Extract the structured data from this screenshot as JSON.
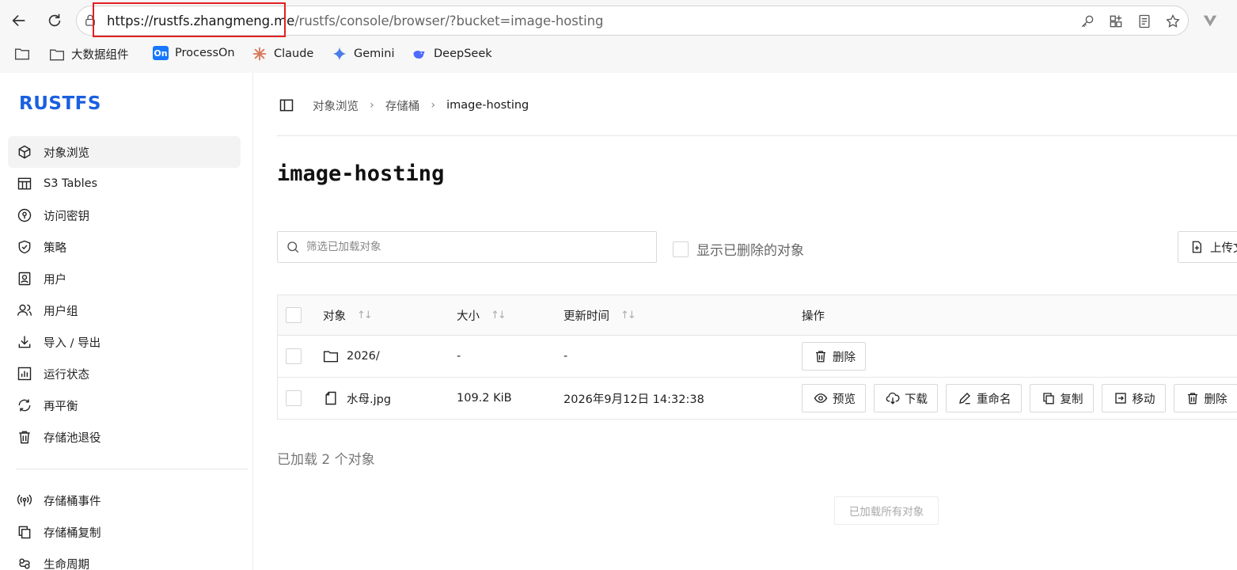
{
  "browser": {
    "url_host": "https://rustfs.zhangmeng.me",
    "url_path": "/rustfs/console/browser/?bucket=image-hosting",
    "bookmarks": [
      {
        "label": "大数据组件"
      },
      {
        "label": "ProcessOn",
        "logo_text": "On"
      },
      {
        "label": "Claude"
      },
      {
        "label": "Gemini"
      },
      {
        "label": "DeepSeek"
      }
    ]
  },
  "sidebar": {
    "logo": "RUSTFS",
    "items": [
      {
        "label": "对象浏览",
        "icon": "cube-icon",
        "active": true
      },
      {
        "label": "S3 Tables",
        "icon": "table-icon"
      },
      {
        "label": "访问密钥",
        "icon": "key-circle-icon"
      },
      {
        "label": "策略",
        "icon": "shield-check-icon"
      },
      {
        "label": "用户",
        "icon": "user-badge-icon"
      },
      {
        "label": "用户组",
        "icon": "users-icon"
      },
      {
        "label": "导入 / 导出",
        "icon": "download-icon"
      },
      {
        "label": "运行状态",
        "icon": "chart-icon"
      },
      {
        "label": "再平衡",
        "icon": "refresh-icon"
      },
      {
        "label": "存储池退役",
        "icon": "trash-icon"
      },
      {
        "label": "存储桶事件",
        "icon": "broadcast-icon"
      },
      {
        "label": "存储桶复制",
        "icon": "copy-icon"
      },
      {
        "label": "生命周期",
        "icon": "lifecycle-icon"
      }
    ]
  },
  "main": {
    "breadcrumbs": [
      "对象浏览",
      "存储桶",
      "image-hosting"
    ],
    "title": "image-hosting",
    "search_placeholder": "筛选已加载对象",
    "show_deleted_label": "显示已删除的对象",
    "upload_label": "上传文件",
    "table": {
      "headers": {
        "name": "对象",
        "size": "大小",
        "time": "更新时间",
        "ops": "操作"
      },
      "rows": [
        {
          "name": "2026/",
          "type": "folder",
          "size": "-",
          "time": "-",
          "ops": [
            "删除"
          ]
        },
        {
          "name": "水母.jpg",
          "type": "file",
          "size": "109.2 KiB",
          "time": "2026年9月12日 14:32:38",
          "ops": [
            "预览",
            "下载",
            "重命名",
            "复制",
            "移动",
            "删除"
          ]
        }
      ]
    },
    "loaded_count": "已加载 2 个对象",
    "all_loaded": "已加载所有对象"
  },
  "colors": {
    "brand": "#1a5fe0",
    "highlight_box": "#e02020"
  }
}
